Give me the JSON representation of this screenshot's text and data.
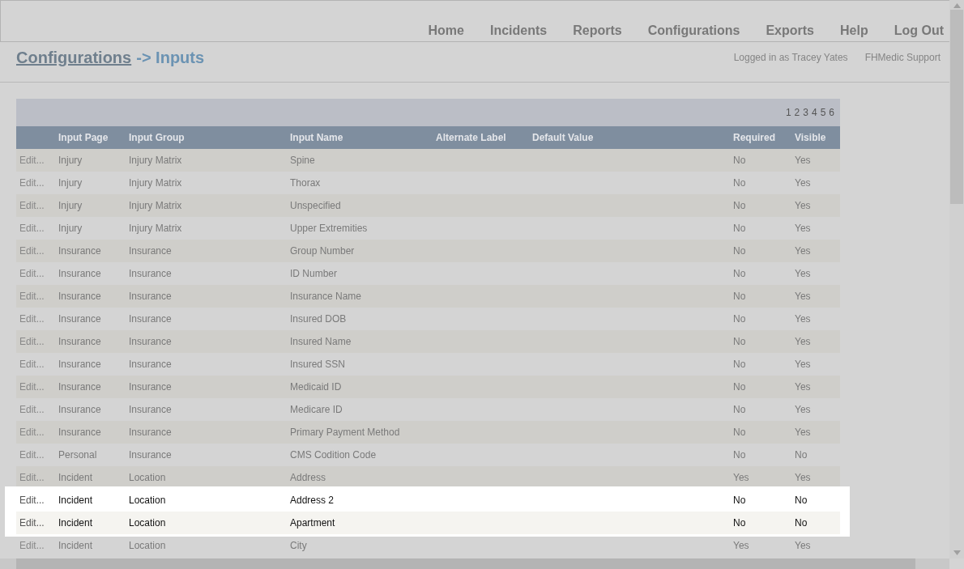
{
  "nav": [
    {
      "label": "Home"
    },
    {
      "label": "Incidents"
    },
    {
      "label": "Reports"
    },
    {
      "label": "Configurations"
    },
    {
      "label": "Exports"
    },
    {
      "label": "Help"
    },
    {
      "label": "Log Out"
    }
  ],
  "breadcrumb": {
    "link": "Configurations",
    "current": "-> Inputs"
  },
  "user_info": [
    "Logged in as Tracey Yates",
    "FHMedic Support"
  ],
  "pager": [
    "1",
    "2",
    "3",
    "4",
    "5",
    "6"
  ],
  "table": {
    "columns": [
      "Input Page",
      "Input Group",
      "Input Name",
      "Alternate Label",
      "Default Value",
      "Required",
      "Visible"
    ],
    "rows": [
      {
        "edit": "Edit...",
        "input_page": "Injury",
        "input_group": "Injury Matrix",
        "input_name": "Spine",
        "required": "No",
        "visible": "Yes",
        "highlighted": false
      },
      {
        "edit": "Edit...",
        "input_page": "Injury",
        "input_group": "Injury Matrix",
        "input_name": "Thorax",
        "required": "No",
        "visible": "Yes",
        "highlighted": false
      },
      {
        "edit": "Edit...",
        "input_page": "Injury",
        "input_group": "Injury Matrix",
        "input_name": "Unspecified",
        "required": "No",
        "visible": "Yes",
        "highlighted": false
      },
      {
        "edit": "Edit...",
        "input_page": "Injury",
        "input_group": "Injury Matrix",
        "input_name": "Upper Extremities",
        "required": "No",
        "visible": "Yes",
        "highlighted": false
      },
      {
        "edit": "Edit...",
        "input_page": "Insurance",
        "input_group": "Insurance",
        "input_name": "Group Number",
        "required": "No",
        "visible": "Yes",
        "highlighted": false
      },
      {
        "edit": "Edit...",
        "input_page": "Insurance",
        "input_group": "Insurance",
        "input_name": "ID Number",
        "required": "No",
        "visible": "Yes",
        "highlighted": false
      },
      {
        "edit": "Edit...",
        "input_page": "Insurance",
        "input_group": "Insurance",
        "input_name": "Insurance Name",
        "required": "No",
        "visible": "Yes",
        "highlighted": false
      },
      {
        "edit": "Edit...",
        "input_page": "Insurance",
        "input_group": "Insurance",
        "input_name": "Insured DOB",
        "required": "No",
        "visible": "Yes",
        "highlighted": false
      },
      {
        "edit": "Edit...",
        "input_page": "Insurance",
        "input_group": "Insurance",
        "input_name": "Insured Name",
        "required": "No",
        "visible": "Yes",
        "highlighted": false
      },
      {
        "edit": "Edit...",
        "input_page": "Insurance",
        "input_group": "Insurance",
        "input_name": "Insured SSN",
        "required": "No",
        "visible": "Yes",
        "highlighted": false
      },
      {
        "edit": "Edit...",
        "input_page": "Insurance",
        "input_group": "Insurance",
        "input_name": "Medicaid ID",
        "required": "No",
        "visible": "Yes",
        "highlighted": false
      },
      {
        "edit": "Edit...",
        "input_page": "Insurance",
        "input_group": "Insurance",
        "input_name": "Medicare ID",
        "required": "No",
        "visible": "Yes",
        "highlighted": false
      },
      {
        "edit": "Edit...",
        "input_page": "Insurance",
        "input_group": "Insurance",
        "input_name": "Primary Payment Method",
        "required": "No",
        "visible": "Yes",
        "highlighted": false
      },
      {
        "edit": "Edit...",
        "input_page": "Personal",
        "input_group": "Insurance",
        "input_name": "CMS Codition Code",
        "required": "No",
        "visible": "No",
        "highlighted": false
      },
      {
        "edit": "Edit...",
        "input_page": "Incident",
        "input_group": "Location",
        "input_name": "Address",
        "required": "Yes",
        "visible": "Yes",
        "highlighted": false
      },
      {
        "edit": "Edit...",
        "input_page": "Incident",
        "input_group": "Location",
        "input_name": "Address 2",
        "required": "No",
        "visible": "No",
        "highlighted": true
      },
      {
        "edit": "Edit...",
        "input_page": "Incident",
        "input_group": "Location",
        "input_name": "Apartment",
        "required": "No",
        "visible": "No",
        "highlighted": true
      },
      {
        "edit": "Edit...",
        "input_page": "Incident",
        "input_group": "Location",
        "input_name": "City",
        "required": "Yes",
        "visible": "Yes",
        "highlighted": false
      }
    ]
  }
}
